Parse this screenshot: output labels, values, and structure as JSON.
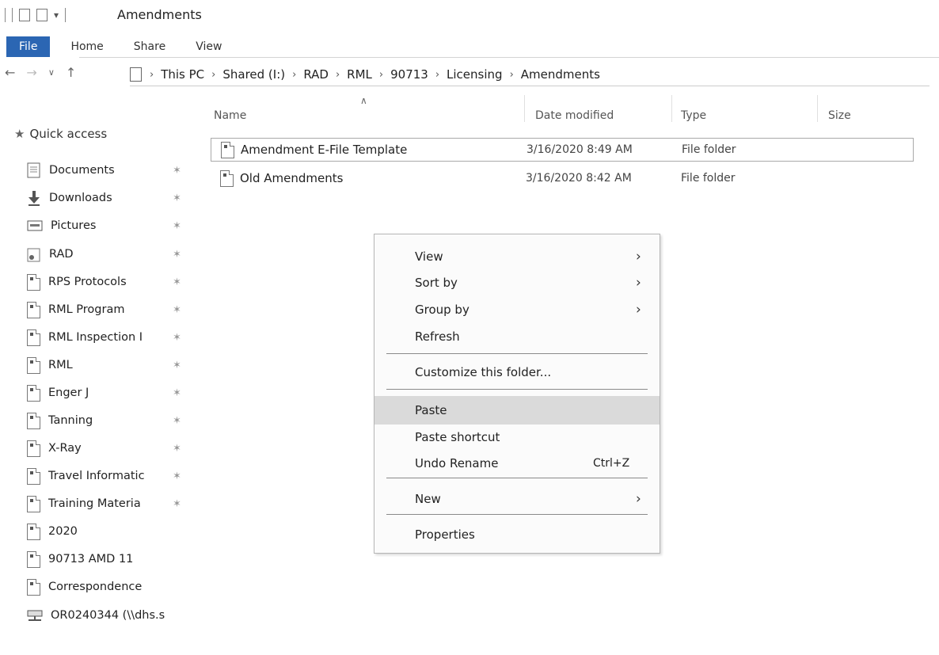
{
  "window": {
    "title": "Amendments"
  },
  "ribbon": {
    "tabs": [
      "File",
      "Home",
      "Share",
      "View"
    ]
  },
  "address": {
    "crumbs": [
      "This PC",
      "Shared (I:)",
      "RAD",
      "RML",
      "90713",
      "Licensing",
      "Amendments"
    ]
  },
  "columns": {
    "name": "Name",
    "date": "Date modified",
    "type": "Type",
    "size": "Size"
  },
  "files": [
    {
      "name": "Amendment E-File Template",
      "date": "3/16/2020 8:49 AM",
      "type": "File folder"
    },
    {
      "name": "Old Amendments",
      "date": "3/16/2020 8:42 AM",
      "type": "File folder"
    }
  ],
  "nav": {
    "quick_access": "Quick access",
    "items": [
      {
        "label": "Documents",
        "icon": "documents-icon",
        "pinned": true
      },
      {
        "label": "Downloads",
        "icon": "download-arrow-icon",
        "pinned": true
      },
      {
        "label": "Pictures",
        "icon": "pictures-icon",
        "pinned": true
      },
      {
        "label": "RAD",
        "icon": "radiation-folder-icon",
        "pinned": true
      },
      {
        "label": "RPS Protocols",
        "icon": "folder-icon",
        "pinned": true
      },
      {
        "label": "RML Program",
        "icon": "folder-icon",
        "pinned": true
      },
      {
        "label": "RML Inspection I",
        "icon": "folder-icon",
        "pinned": true
      },
      {
        "label": "RML",
        "icon": "folder-icon",
        "pinned": true
      },
      {
        "label": "Enger J",
        "icon": "folder-icon",
        "pinned": true
      },
      {
        "label": "Tanning",
        "icon": "folder-icon",
        "pinned": true
      },
      {
        "label": "X-Ray",
        "icon": "folder-icon",
        "pinned": true
      },
      {
        "label": "Travel Informatic",
        "icon": "folder-icon",
        "pinned": true
      },
      {
        "label": "Training Materia",
        "icon": "folder-icon",
        "pinned": true
      },
      {
        "label": "2020",
        "icon": "folder-icon",
        "pinned": false
      },
      {
        "label": "90713 AMD 11",
        "icon": "folder-icon",
        "pinned": false
      },
      {
        "label": "Correspondence",
        "icon": "folder-icon",
        "pinned": false
      },
      {
        "label": "OR0240344 (\\\\dhs.s",
        "icon": "network-drive-icon",
        "pinned": false
      }
    ]
  },
  "context_menu": {
    "view": "View",
    "sort_by": "Sort by",
    "group_by": "Group by",
    "refresh": "Refresh",
    "customize": "Customize this folder...",
    "paste": "Paste",
    "paste_shortcut": "Paste shortcut",
    "undo_rename": "Undo Rename",
    "undo_shortcut": "Ctrl+Z",
    "new": "New",
    "properties": "Properties"
  },
  "colors": {
    "file_tab": "#2b66b3",
    "highlight": "#dadada"
  }
}
